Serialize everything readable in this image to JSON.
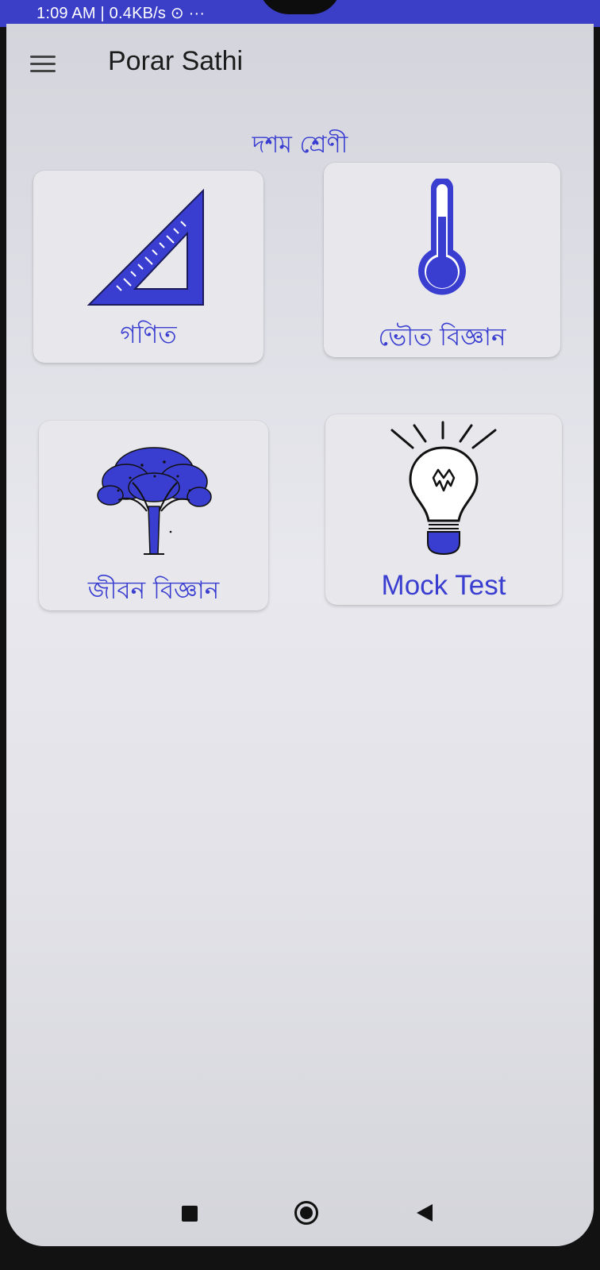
{
  "status_bar": {
    "time_text": "1:09 AM | 0.4KB/s ⊙ ···"
  },
  "toolbar": {
    "title": "Porar Sathi",
    "menu_icon": "hamburger-menu-icon"
  },
  "page": {
    "heading": "দশম শ্রেণী"
  },
  "subjects": [
    {
      "label": "গণিত",
      "icon": "set-square-ruler-icon"
    },
    {
      "label": "ভৌত বিজ্ঞান",
      "icon": "thermometer-icon"
    },
    {
      "label": "জীবন বিজ্ঞান",
      "icon": "tree-icon"
    },
    {
      "label": "Mock Test",
      "icon": "light-bulb-icon"
    }
  ],
  "nav_bar": {
    "icons": [
      "recents-square-icon",
      "home-circle-icon",
      "back-triangle-icon"
    ]
  },
  "colors": {
    "accent": "#3a3ed0",
    "status_bar": "#3b3fc7",
    "card_background": "#e8e8ec"
  }
}
